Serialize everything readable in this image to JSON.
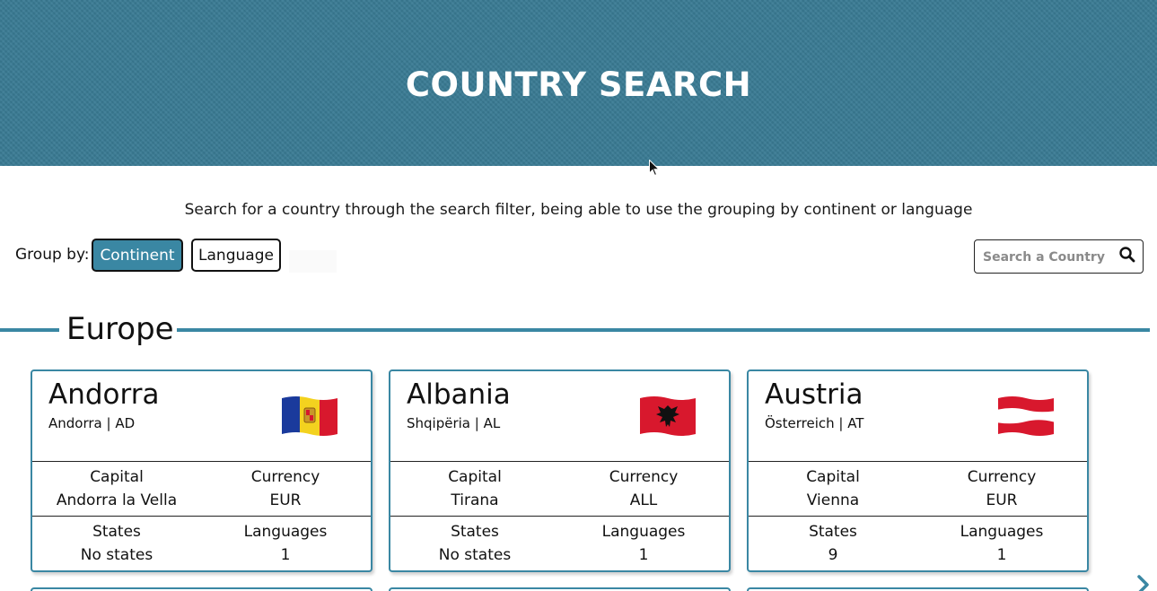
{
  "header": {
    "title": "COUNTRY SEARCH"
  },
  "subtitle": "Search for a country through the search filter, being able to use the grouping by continent or language",
  "group_by": {
    "label": "Group by:",
    "options": [
      {
        "label": "Continent",
        "active": true
      },
      {
        "label": "Language",
        "active": false
      }
    ]
  },
  "search": {
    "placeholder": "Search a Country",
    "value": ""
  },
  "section": {
    "title": "Europe"
  },
  "labels": {
    "capital": "Capital",
    "currency": "Currency",
    "states": "States",
    "languages": "Languages"
  },
  "countries": [
    {
      "name": "Andorra",
      "native": "Andorra | AD",
      "capital": "Andorra la Vella",
      "currency": "EUR",
      "states": "No states",
      "languages": "1",
      "flag": "andorra-flag"
    },
    {
      "name": "Albania",
      "native": "Shqipëria | AL",
      "capital": "Tirana",
      "currency": "ALL",
      "states": "No states",
      "languages": "1",
      "flag": "albania-flag"
    },
    {
      "name": "Austria",
      "native": "Österreich | AT",
      "capital": "Vienna",
      "currency": "EUR",
      "states": "9",
      "languages": "1",
      "flag": "austria-flag"
    }
  ],
  "colors": {
    "header_bg": "#3a7b94",
    "accent": "#3a87a3"
  }
}
